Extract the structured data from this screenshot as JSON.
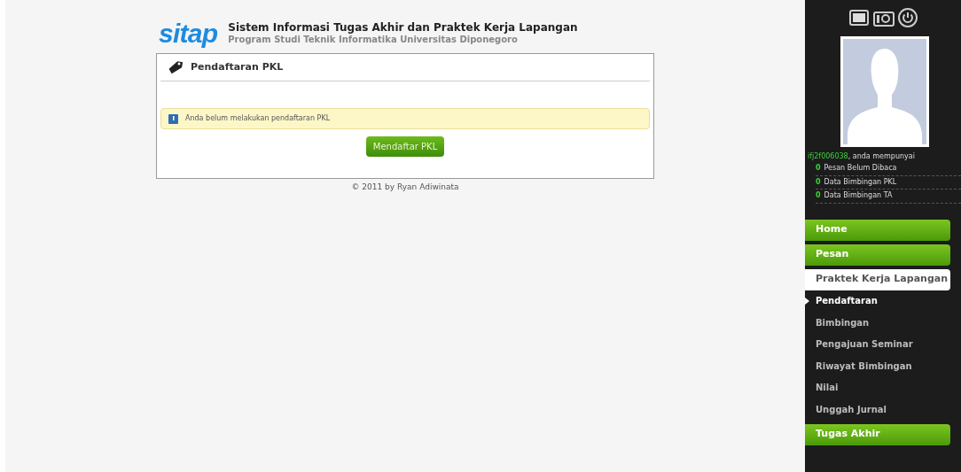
{
  "header": {
    "logo": "sitap",
    "title": "Sistem Informasi Tugas Akhir dan Praktek Kerja Lapangan",
    "subtitle": "Program Studi Teknik Informatika Universitas Diponegoro"
  },
  "panel": {
    "title": "Pendaftaran PKL",
    "notice": "Anda belum melakukan pendaftaran PKL",
    "button": "Mendaftar PKL"
  },
  "footer": "© 2011 by Ryan Adiwinata",
  "user": {
    "username": "ifj2f006038",
    "message": ", anda mempunyai",
    "stats": [
      {
        "count": "0",
        "label": "Pesan Belum Dibaca"
      },
      {
        "count": "0",
        "label": "Data Bimbingan PKL"
      },
      {
        "count": "0",
        "label": "Data Bimbingan TA"
      }
    ]
  },
  "nav": [
    {
      "kind": "section",
      "label": "Home",
      "selected": false
    },
    {
      "kind": "section",
      "label": "Pesan",
      "selected": false
    },
    {
      "kind": "section",
      "label": "Praktek Kerja Lapangan",
      "selected": true
    },
    {
      "kind": "sub",
      "label": "Pendaftaran",
      "selected": true
    },
    {
      "kind": "sub",
      "label": "Bimbingan",
      "selected": false
    },
    {
      "kind": "sub",
      "label": "Pengajuan Seminar",
      "selected": false
    },
    {
      "kind": "sub",
      "label": "Riwayat Bimbingan",
      "selected": false
    },
    {
      "kind": "sub",
      "label": "Nilai",
      "selected": false
    },
    {
      "kind": "sub",
      "label": "Unggah Jurnal",
      "selected": false
    },
    {
      "kind": "section",
      "label": "Tugas Akhir",
      "selected": false
    }
  ]
}
